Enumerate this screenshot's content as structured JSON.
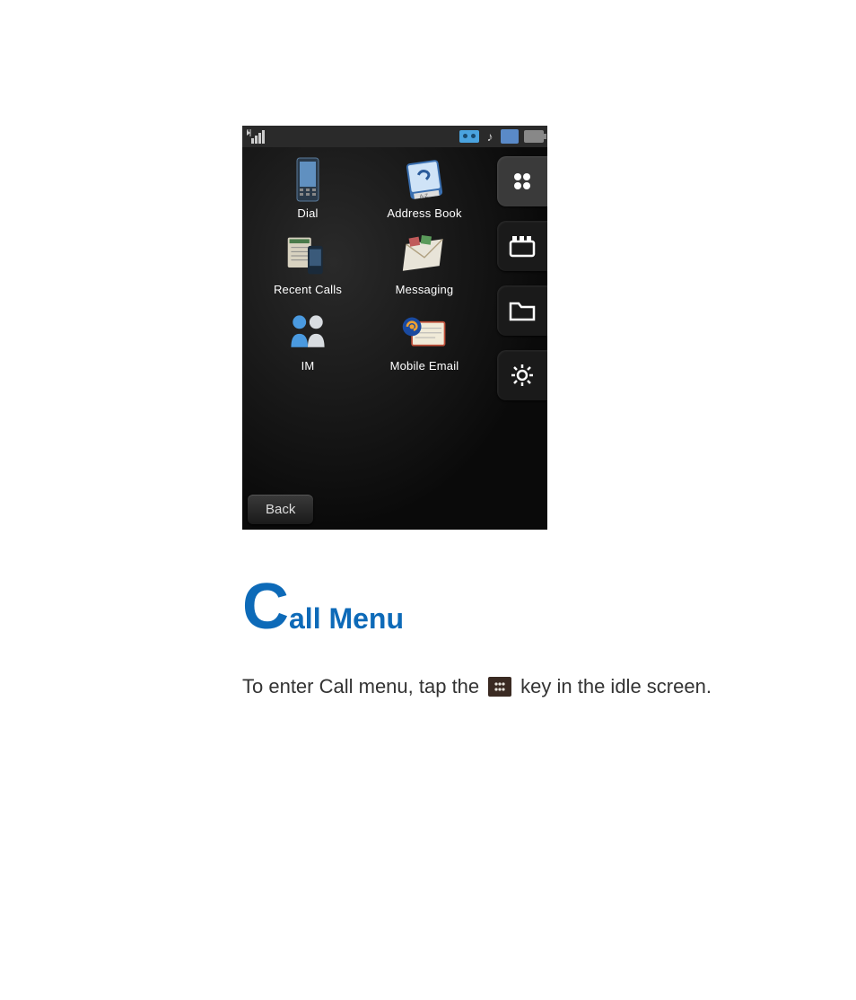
{
  "phone": {
    "apps": [
      {
        "label": "Dial",
        "icon": "dial"
      },
      {
        "label": "Address Book",
        "icon": "addressbook"
      },
      {
        "label": "Recent Calls",
        "icon": "recentcalls"
      },
      {
        "label": "Messaging",
        "icon": "messaging"
      },
      {
        "label": "IM",
        "icon": "im"
      },
      {
        "label": "Mobile Email",
        "icon": "mobileemail"
      }
    ],
    "back_label": "Back"
  },
  "heading": {
    "dropcap": "C",
    "rest": "all Menu"
  },
  "body": {
    "before": "To enter Call menu, tap the",
    "after": "key in the idle screen."
  }
}
